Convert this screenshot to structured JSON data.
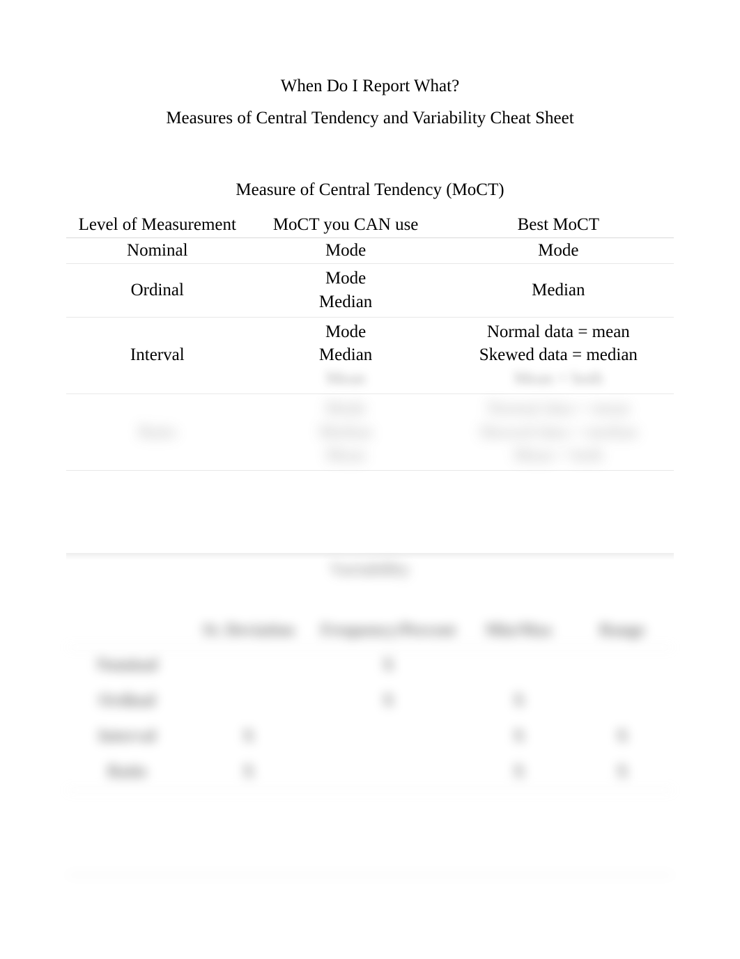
{
  "title": "When Do I Report What?",
  "subtitle": "Measures of Central Tendency and Variability Cheat Sheet",
  "moct": {
    "heading": "Measure of Central Tendency (MoCT)",
    "headers": {
      "c1": "Level of Measurement",
      "c2": "MoCT you CAN use",
      "c3": "Best MoCT"
    },
    "rows": [
      {
        "level": "Nominal",
        "can": "Mode",
        "best": "Mode"
      },
      {
        "level": "Ordinal",
        "can": "Mode\nMedian",
        "best": "Median"
      },
      {
        "level": "Interval",
        "can": "Mode\nMedian\nMean",
        "best": "Normal data = mean\nSkewed data = median\nMean + both"
      },
      {
        "level": "Ratio",
        "can": "Mode\nMedian\nMean",
        "best": "Normal data = mean\nSkewed data = median\nMean + both"
      }
    ]
  },
  "variability": {
    "heading": "Variability",
    "headers": {
      "c1": "",
      "c2": "St. Deviation",
      "c3": "Frequency/Percent",
      "c4": "Min/Max",
      "c5": "Range"
    },
    "rows": [
      {
        "level": "Nominal",
        "sd": "",
        "fp": "X",
        "mm": "",
        "rg": ""
      },
      {
        "level": "Ordinal",
        "sd": "",
        "fp": "X",
        "mm": "X",
        "rg": ""
      },
      {
        "level": "Interval",
        "sd": "X",
        "fp": "",
        "mm": "X",
        "rg": "X"
      },
      {
        "level": "Ratio",
        "sd": "X",
        "fp": "",
        "mm": "X",
        "rg": "X"
      }
    ]
  }
}
